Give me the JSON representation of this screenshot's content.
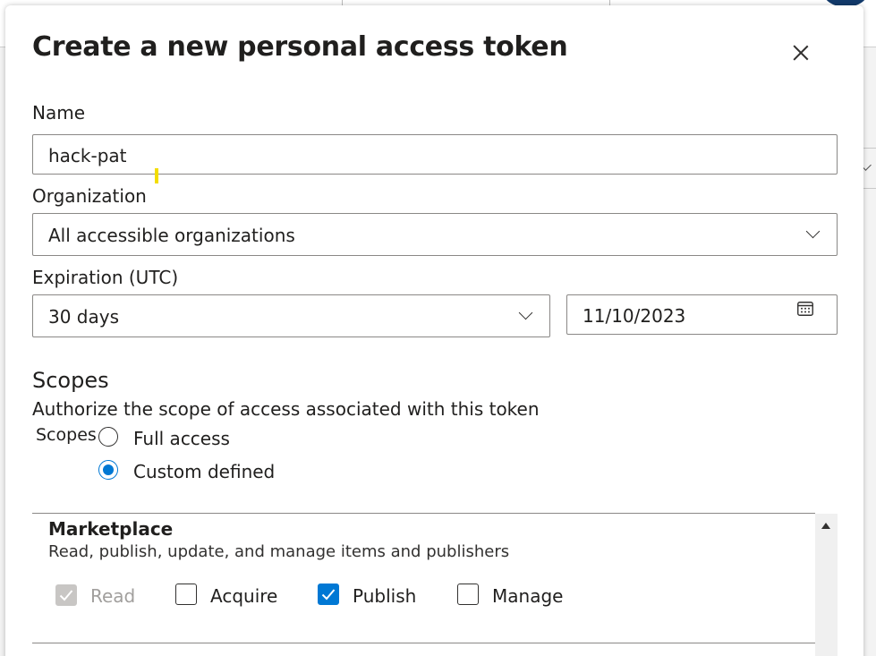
{
  "dialog": {
    "title": "Create a new personal access token"
  },
  "form": {
    "name_label": "Name",
    "name_value": "hack-pat",
    "organization_label": "Organization",
    "organization_value": "All accessible organizations",
    "expiration_label": "Expiration (UTC)",
    "expiration_value": "30 days",
    "expiration_date": "11/10/2023"
  },
  "scopes": {
    "heading": "Scopes",
    "description": "Authorize the scope of access associated with this token",
    "group_label": "Scopes",
    "options": [
      {
        "label": "Full access",
        "selected": false
      },
      {
        "label": "Custom defined",
        "selected": true
      }
    ],
    "marketplace": {
      "title": "Marketplace",
      "description": "Read, publish, update, and manage items and publishers",
      "permissions": [
        {
          "label": "Read",
          "checked": true,
          "disabled": true
        },
        {
          "label": "Acquire",
          "checked": false,
          "disabled": false
        },
        {
          "label": "Publish",
          "checked": true,
          "disabled": false
        },
        {
          "label": "Manage",
          "checked": false,
          "disabled": false
        }
      ]
    }
  },
  "colors": {
    "accent": "#0078d4",
    "disabled": "#c8c6c4",
    "border": "#8a8886"
  }
}
